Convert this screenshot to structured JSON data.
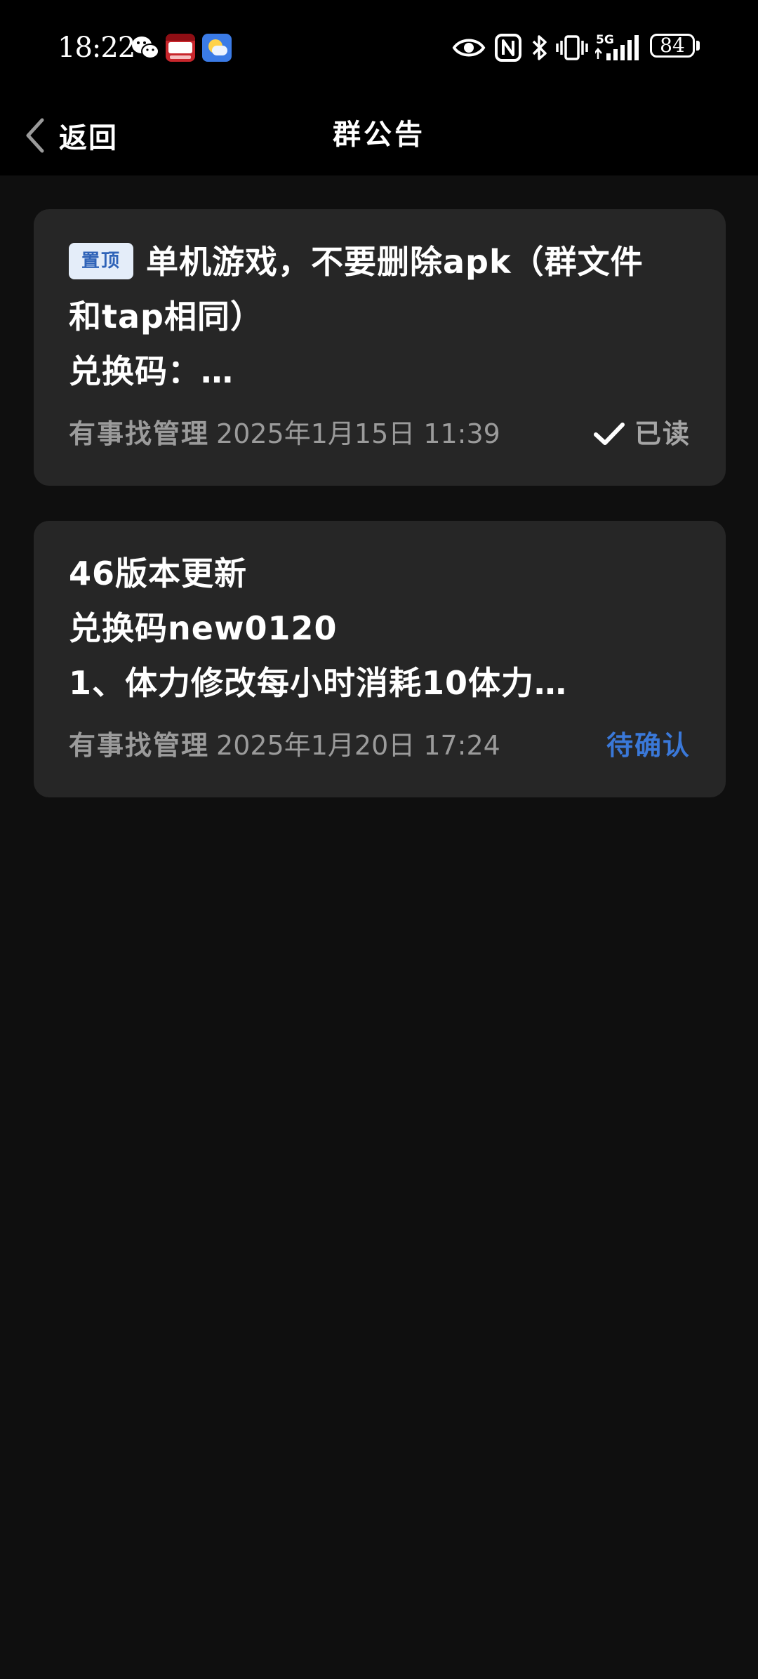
{
  "status_bar": {
    "time": "18:22",
    "battery_level": "84",
    "notification_icons": [
      "wechat-icon",
      "app-icon",
      "weather-icon"
    ],
    "system_icons": [
      "eye-icon",
      "nfc-icon",
      "bluetooth-icon",
      "vibrate-icon",
      "signal-5g-icon",
      "battery-icon"
    ]
  },
  "header": {
    "back_label": "返回",
    "title": "群公告"
  },
  "announcements": [
    {
      "pinned_label": "置顶",
      "lines": [
        "单机游戏，不要删除apk（群文件",
        "和tap相同）",
        "兑换码：…"
      ],
      "author": "有事找管理",
      "date": "2025年1月15日 11:39",
      "status": "已读"
    },
    {
      "lines": [
        "46版本更新",
        "兑换码new0120",
        "1、体力修改每小时消耗10体力…"
      ],
      "author": "有事找管理",
      "date": "2025年1月20日 17:24",
      "status": "待确认"
    }
  ],
  "colors": {
    "background": "#0f0f0f",
    "card": "#262626",
    "accent_blue": "#3a78d8",
    "badge_bg": "#e4edf9",
    "meta_text": "#9b9b9b"
  }
}
